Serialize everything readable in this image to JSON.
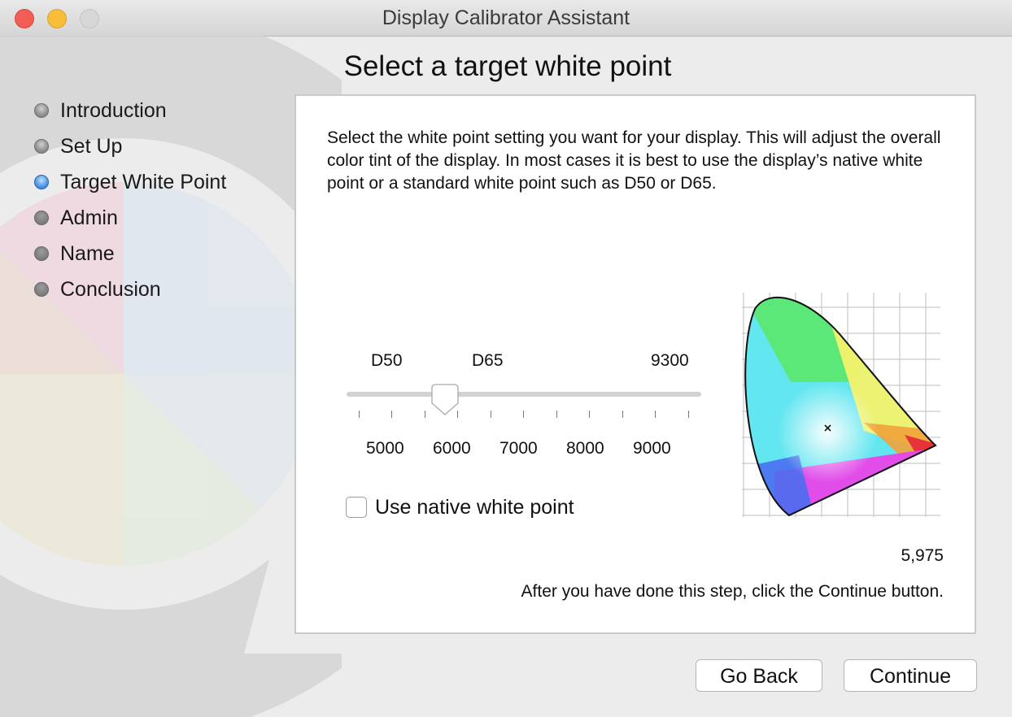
{
  "window": {
    "title": "Display Calibrator Assistant"
  },
  "page": {
    "title": "Select a target white point"
  },
  "steps": [
    {
      "label": "Introduction",
      "state": "done"
    },
    {
      "label": "Set Up",
      "state": "done"
    },
    {
      "label": "Target White Point",
      "state": "current"
    },
    {
      "label": "Admin",
      "state": "pending"
    },
    {
      "label": "Name",
      "state": "pending"
    },
    {
      "label": "Conclusion",
      "state": "pending"
    }
  ],
  "content": {
    "description": "Select the white point setting you want for your display.  This will adjust the overall color tint of the display.  In most cases it is best to use the display’s native white point or a standard white point such as D50 or D65.",
    "slider": {
      "top_labels": [
        "D50",
        "D65",
        "9300"
      ],
      "tick_labels": [
        "5000",
        "6000",
        "7000",
        "8000",
        "9000"
      ],
      "min": 4500,
      "max": 9800,
      "value": 5975
    },
    "native_checkbox": {
      "label": "Use native white point",
      "checked": false
    },
    "readout": "5,975",
    "instruction": "After you have done this step, click the Continue button."
  },
  "buttons": {
    "back": "Go Back",
    "continue": "Continue"
  },
  "colors": {
    "accent": "#4c97e6",
    "close": "#f25d55",
    "minimize": "#f8be3a"
  }
}
